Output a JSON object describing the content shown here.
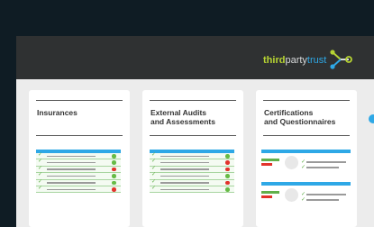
{
  "logo": {
    "part1": "third",
    "part2": "party",
    "part3": "trust"
  },
  "cards": [
    {
      "title": "Insurances"
    },
    {
      "title": "External Audits\nand Assessments"
    },
    {
      "title": "Certifications\nand Questionnaires"
    }
  ],
  "insurance_rows": [
    "ok",
    "ok",
    "bad",
    "ok",
    "ok",
    "bad"
  ],
  "audit_rows": [
    "ok",
    "bad",
    "bad",
    "ok",
    "bad",
    "ok"
  ],
  "colors": {
    "accent": "#2ea8e6",
    "ok": "#66bb45",
    "bad": "#e2332b",
    "brand_green": "#b7d433"
  },
  "icons": {
    "check": "check-icon",
    "logo_mark": "connector-arrow-icon"
  }
}
